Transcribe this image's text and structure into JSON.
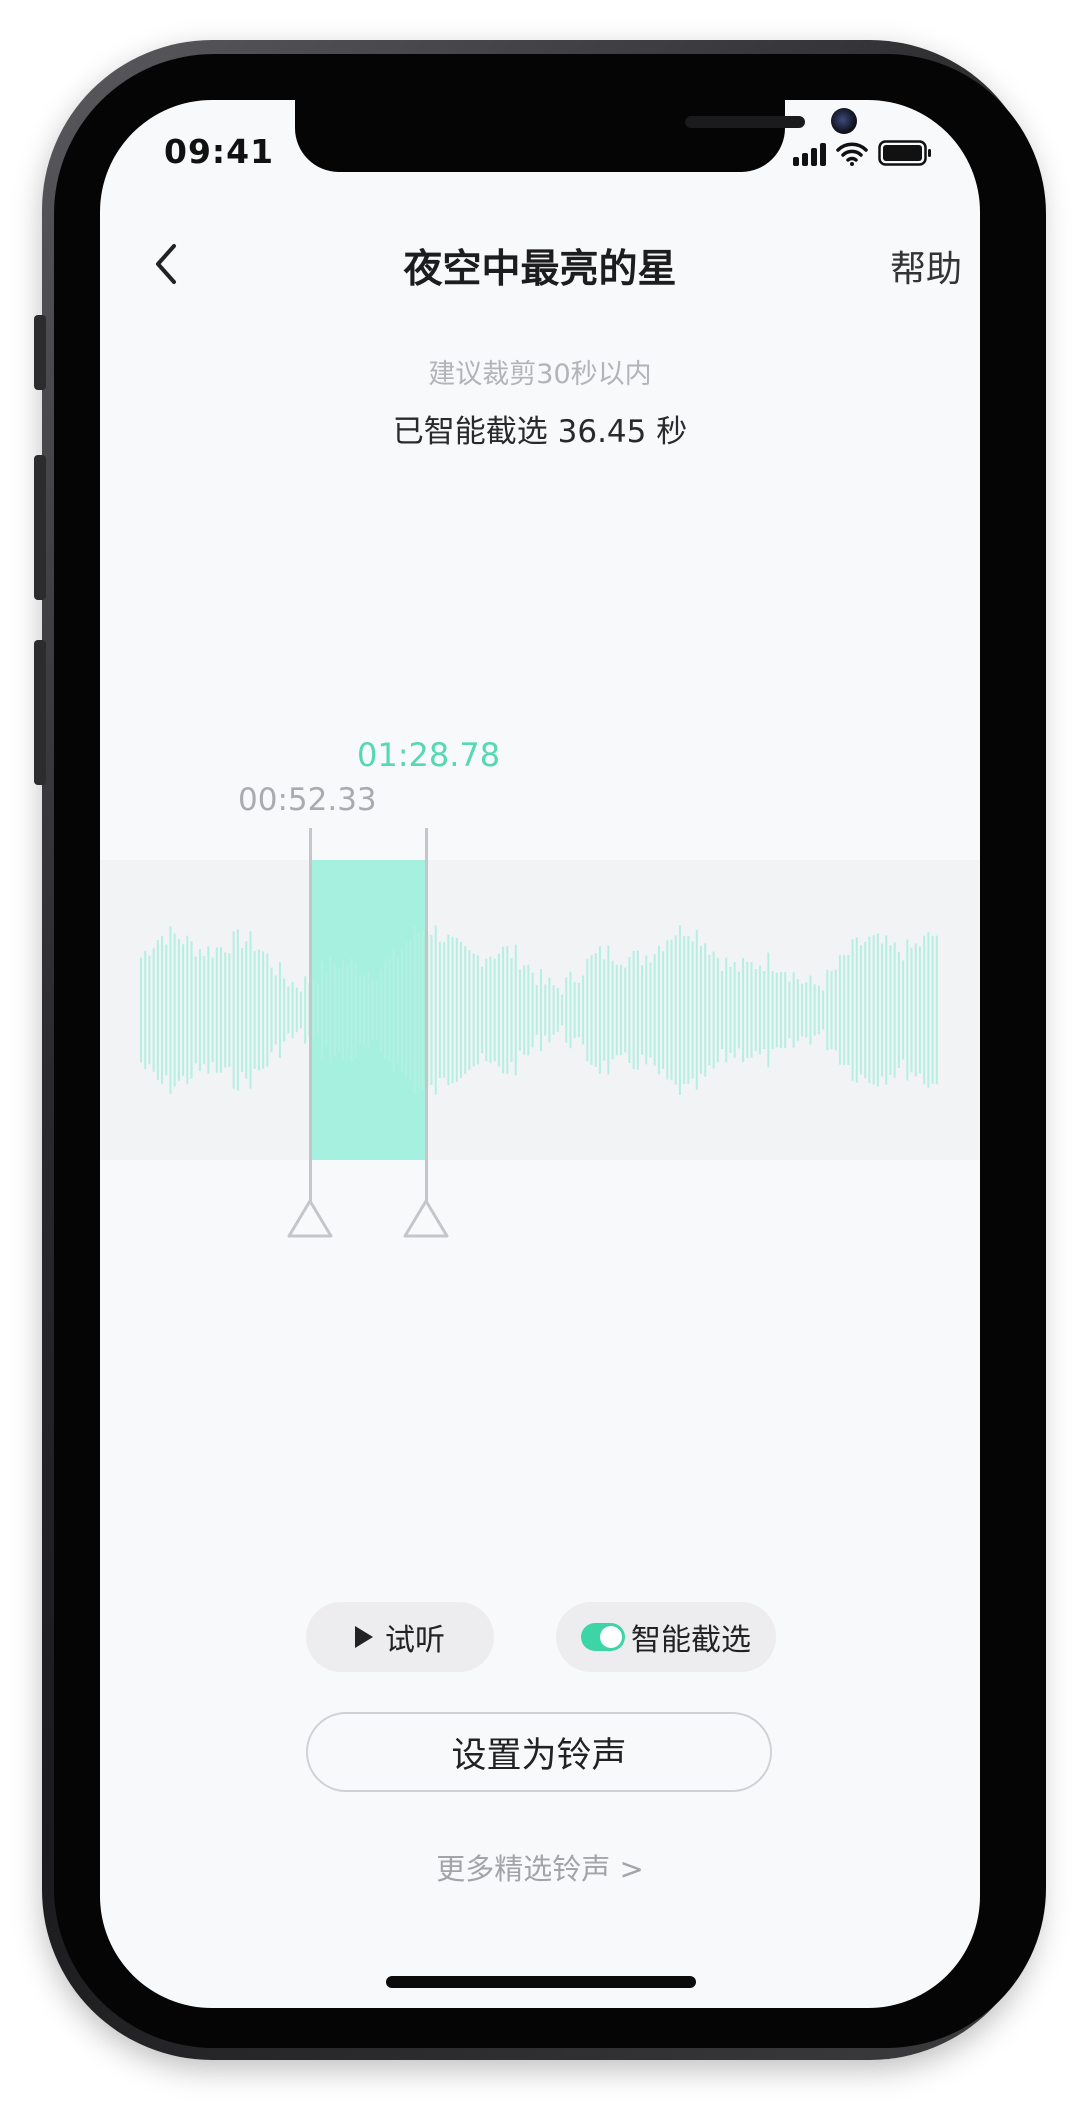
{
  "status_bar": {
    "time": "09:41"
  },
  "nav": {
    "title": "夜空中最亮的星",
    "help_label": "帮助"
  },
  "editor": {
    "hint": "建议裁剪30秒以内",
    "selected_duration": "已智能截选 36.45 秒",
    "start_time": "00:52.33",
    "end_time": "01:28.78"
  },
  "controls": {
    "preview_label": "试听",
    "smart_select_label": "智能截选",
    "smart_select_on": true
  },
  "actions": {
    "set_ringtone_label": "设置为铃声",
    "more_ringtones_label": "更多精选铃声 >"
  },
  "colors": {
    "accent": "#3ed5a6",
    "selection": "#a6f0df",
    "waveform": "#b4f0e2",
    "time_end": "#56d8b1"
  },
  "icons": {
    "back": "chevron-left-icon",
    "play": "play-icon",
    "signal": "cellular-signal-icon",
    "wifi": "wifi-icon",
    "battery": "battery-icon"
  }
}
